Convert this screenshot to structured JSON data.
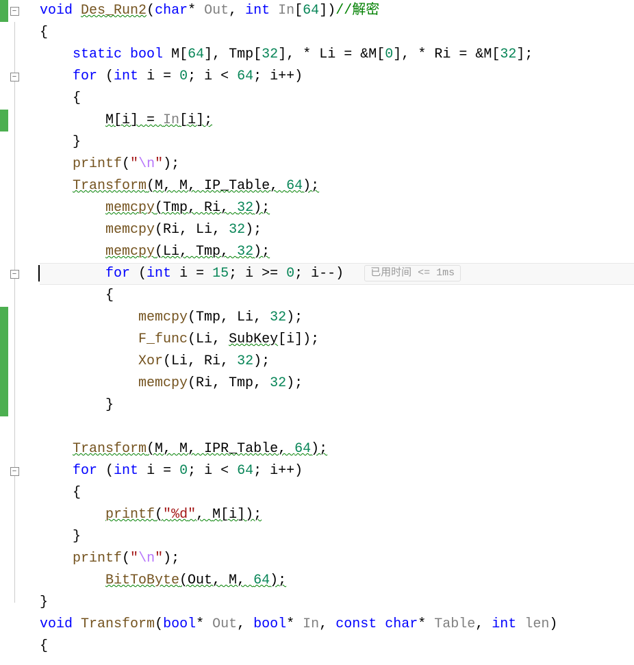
{
  "code": {
    "l1": {
      "kw_void": "void",
      "fn": "Des_Run2",
      "p_open": "(",
      "kw_char": "char",
      "star": "* ",
      "p_out": "Out",
      "comma": ", ",
      "kw_int": "int",
      "p_in": " In",
      "arr": "[",
      "sz": "64",
      "arr2": "])",
      "cmt": "//解密"
    },
    "l2": "{",
    "l3": {
      "kw_static": "static",
      "kw_bool": "bool",
      "m": "M",
      "b0": "[",
      "n64": "64",
      "b1": "], ",
      "tmp": "Tmp",
      "b2": "[",
      "n32": "32",
      "b3": "], ",
      "star1": "* ",
      "li": "Li",
      "eq1": " = &",
      "m1": "M",
      "b4": "[",
      "n0": "0",
      "b5": "], ",
      "star2": "* ",
      "ri": "Ri",
      "eq2": " = &",
      "m2": "M",
      "b6": "[",
      "n32b": "32",
      "b7": "];"
    },
    "l4": {
      "kw_for": "for",
      "open": " (",
      "kw_int": "int",
      "i": " i = ",
      "n0": "0",
      "semi": "; i < ",
      "n64": "64",
      "semi2": "; i++)"
    },
    "l5": "{",
    "l6": {
      "m": "M",
      "b0": "[i] = ",
      "in": "In",
      "b1": "[i];"
    },
    "l7": "}",
    "l8": {
      "fn": "printf",
      "p": "(",
      "q1": "\"",
      "esc": "\\n",
      "q2": "\"",
      ")": ");"
    },
    "l9": {
      "fn": "Transform",
      "args": "(M, M, IP_Table, ",
      "n": "64",
      "end": ");"
    },
    "l10": {
      "fn": "memcpy",
      "args": "(Tmp, Ri, ",
      "n": "32",
      "end": ");"
    },
    "l11": {
      "fn": "memcpy",
      "args": "(Ri, Li, ",
      "n": "32",
      "end": ");"
    },
    "l12": {
      "fn": "memcpy",
      "args": "(Li, Tmp, ",
      "n": "32",
      "end": ");"
    },
    "l13": {
      "kw_for": "for",
      "open": " (",
      "kw_int": "int",
      "rest": " i = ",
      "n15": "15",
      "mid": "; i >= ",
      "n0": "0",
      "tail": "; i--)"
    },
    "l14": "{",
    "l15": {
      "fn": "memcpy",
      "args": "(Tmp, Li, ",
      "n": "32",
      "end": ");"
    },
    "l16": {
      "fn": "F_func",
      "args": "(Li, ",
      "sk": "SubKey",
      "b": "[i]);"
    },
    "l17": {
      "fn": "Xor",
      "args": "(Li, Ri, ",
      "n": "32",
      "end": ");"
    },
    "l18": {
      "fn": "memcpy",
      "args": "(Ri, Tmp, ",
      "n": "32",
      "end": ");"
    },
    "l19": "}",
    "l20": "",
    "l21": {
      "fn": "Transform",
      "args": "(M, M, IPR_Table, ",
      "n": "64",
      "end": ");"
    },
    "l22": {
      "kw_for": "for",
      "open": " (",
      "kw_int": "int",
      "i": " i = ",
      "n0": "0",
      "semi": "; i < ",
      "n64": "64",
      "semi2": "; i++)"
    },
    "l23": "{",
    "l24": {
      "fn": "printf",
      "p": "(",
      "q1": "\"",
      "fmt": "%d",
      "q2": "\"",
      ", ": ", ",
      "m": "M",
      "b": "[i]);"
    },
    "l25": "}",
    "l26": {
      "fn": "printf",
      "p": "(",
      "q1": "\"",
      "esc": "\\n",
      "q2": "\"",
      ")": ");"
    },
    "l27": {
      "fn": "BitToByte",
      "args": "(Out, M, ",
      "n": "64",
      "end": ");"
    },
    "l28": "}",
    "l29": {
      "kw_void": "void",
      "fn": "Transform",
      "p": "(",
      "kw_bool": "bool",
      "s1": "* ",
      "out": "Out",
      "c1": ", ",
      "kw_bool2": "bool",
      "s2": "* ",
      "in": "In",
      "c2": ", ",
      "kw_const": "const",
      "sp": " ",
      "kw_char": "char",
      "s3": "* ",
      "tbl": "Table",
      "c3": ", ",
      "kw_int": "int",
      "len": " len",
      ")": ")"
    },
    "l30": "{"
  },
  "perf_hint": "已用时间 <= 1ms",
  "fold": {
    "minus": "−"
  }
}
